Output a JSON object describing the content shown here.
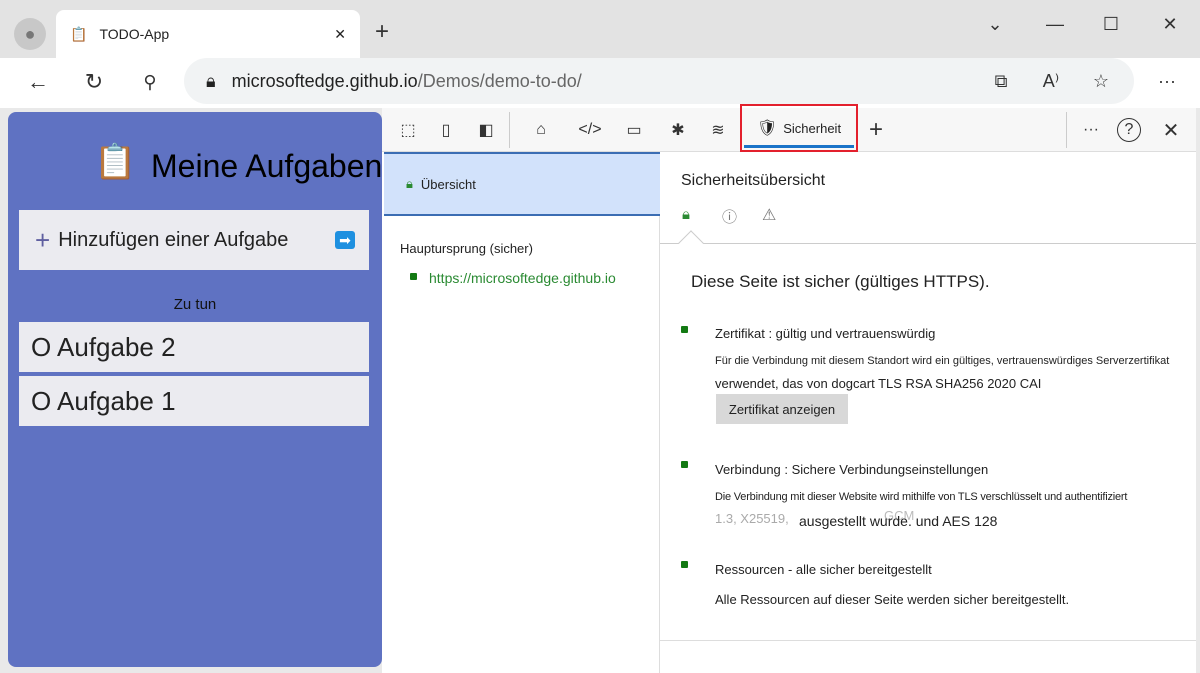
{
  "browser": {
    "tab_title": "TODO-App",
    "url_host": "microsoftedge.github.io",
    "url_path": "/Demos/demo-to-do/"
  },
  "app": {
    "title": "Meine Aufgaben",
    "add_label": "Hinzufügen einer Aufgabe",
    "section": "Zu tun",
    "tasks": [
      "O Aufgabe 2",
      "O Aufgabe 1"
    ]
  },
  "devtools": {
    "security_tab": "Sicherheit",
    "left": {
      "overview": "Übersicht",
      "origin_heading": "Hauptursprung (sicher)",
      "origin": "https://microsoftedge.github.io"
    },
    "right": {
      "title": "Sicherheitsübersicht",
      "summary": "Diese Seite ist sicher (gültiges HTTPS).",
      "cert_title": "Zertifikat : gültig und vertrauenswürdig",
      "cert_desc1": "Für die Verbindung mit diesem Standort wird ein gültiges, vertrauenswürdiges Serverzertifikat",
      "cert_desc2": "verwendet, das von dogcart TLS RSA SHA256 2020 CAI",
      "cert_button": "Zertifikat anzeigen",
      "conn_title": "Verbindung : Sichere Verbindungseinstellungen",
      "conn_desc1": "Die Verbindung mit dieser Website wird mithilfe von TLS verschlüsselt und authentifiziert",
      "conn_faded1": "1.3, X25519,",
      "conn_desc2": "ausgestellt wurde. und AES 128",
      "conn_faded2": "GCM",
      "res_title": "Ressourcen - alle sicher bereitgestellt",
      "res_desc": "Alle Ressourcen auf dieser Seite werden sicher bereitgestellt."
    }
  },
  "colors": {
    "app_bg": "#5f72c2",
    "highlight": "#e3202d",
    "secure": "#137a13"
  }
}
